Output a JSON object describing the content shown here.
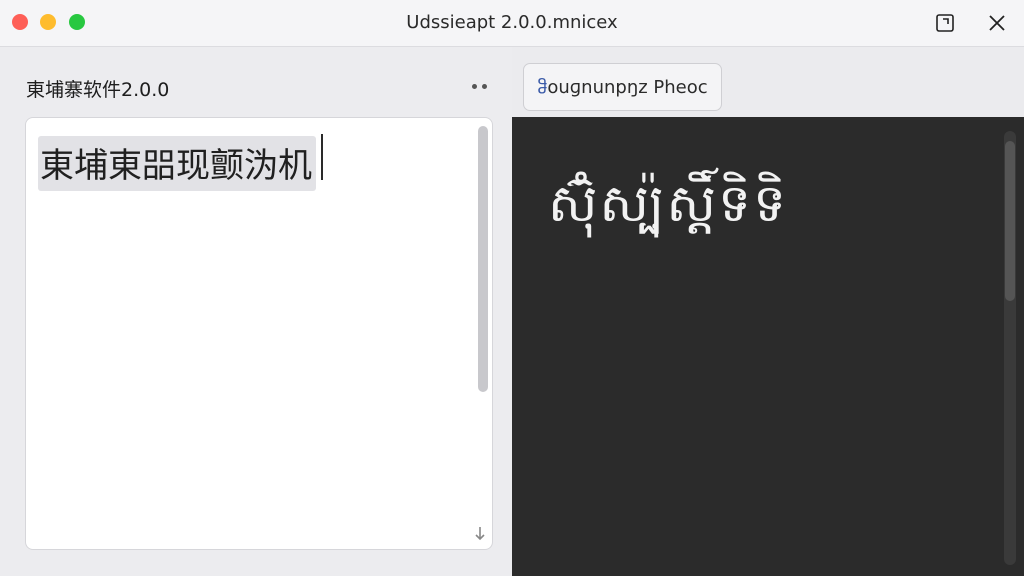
{
  "window": {
    "title": "Udssieapt 2.0.0.mnicex"
  },
  "titlebar": {
    "restore_icon": "restore-icon",
    "close_icon": "close-icon"
  },
  "left_panel": {
    "title": "東埔寨软件2.0.0",
    "more_icon": "more-dots-icon",
    "editor": {
      "value": "東埔東㗊现颤沩机"
    }
  },
  "right_panel": {
    "tab": {
      "label_prefix": "ჵ",
      "label": "ouɡnunpŋz Pheoc"
    },
    "output_text": "ស៊ុំស្ប៉ុស្តិ៍ទិទិ"
  },
  "colors": {
    "titlebar_bg": "#f5f5f7",
    "left_bg": "#ececef",
    "right_bg": "#2b2b2b",
    "accent": "#3a5aa8",
    "traffic_close": "#fe5f57",
    "traffic_min": "#febc2e",
    "traffic_max": "#28c840"
  }
}
